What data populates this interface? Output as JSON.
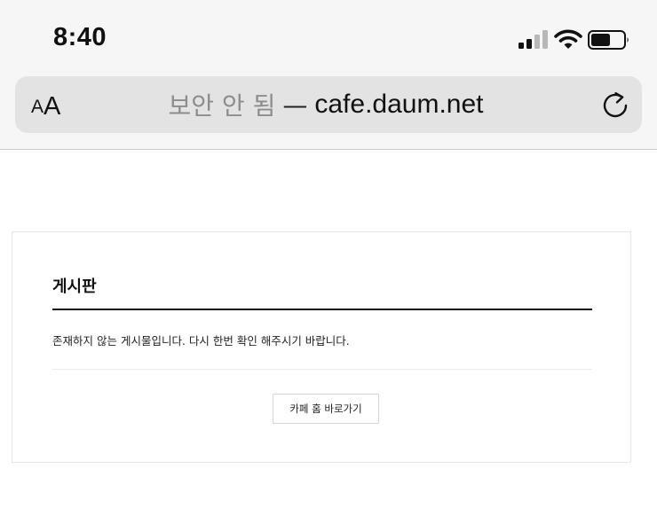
{
  "status_bar": {
    "time": "8:40",
    "signal_icon": "cellular-signal-icon",
    "wifi_icon": "wifi-icon",
    "battery_icon": "battery-icon",
    "battery_level": 0.6
  },
  "browser": {
    "text_size_small": "A",
    "text_size_large": "A",
    "security_label": "보안 안 됨",
    "separator": "—",
    "domain": "cafe.daum.net",
    "reload_icon": "reload-icon"
  },
  "board": {
    "title": "게시판",
    "message": "존재하지 않는 게시물입니다. 다시 한번 확인 해주시기 바랍니다.",
    "home_button_label": "카페 홈 바로가기"
  }
}
